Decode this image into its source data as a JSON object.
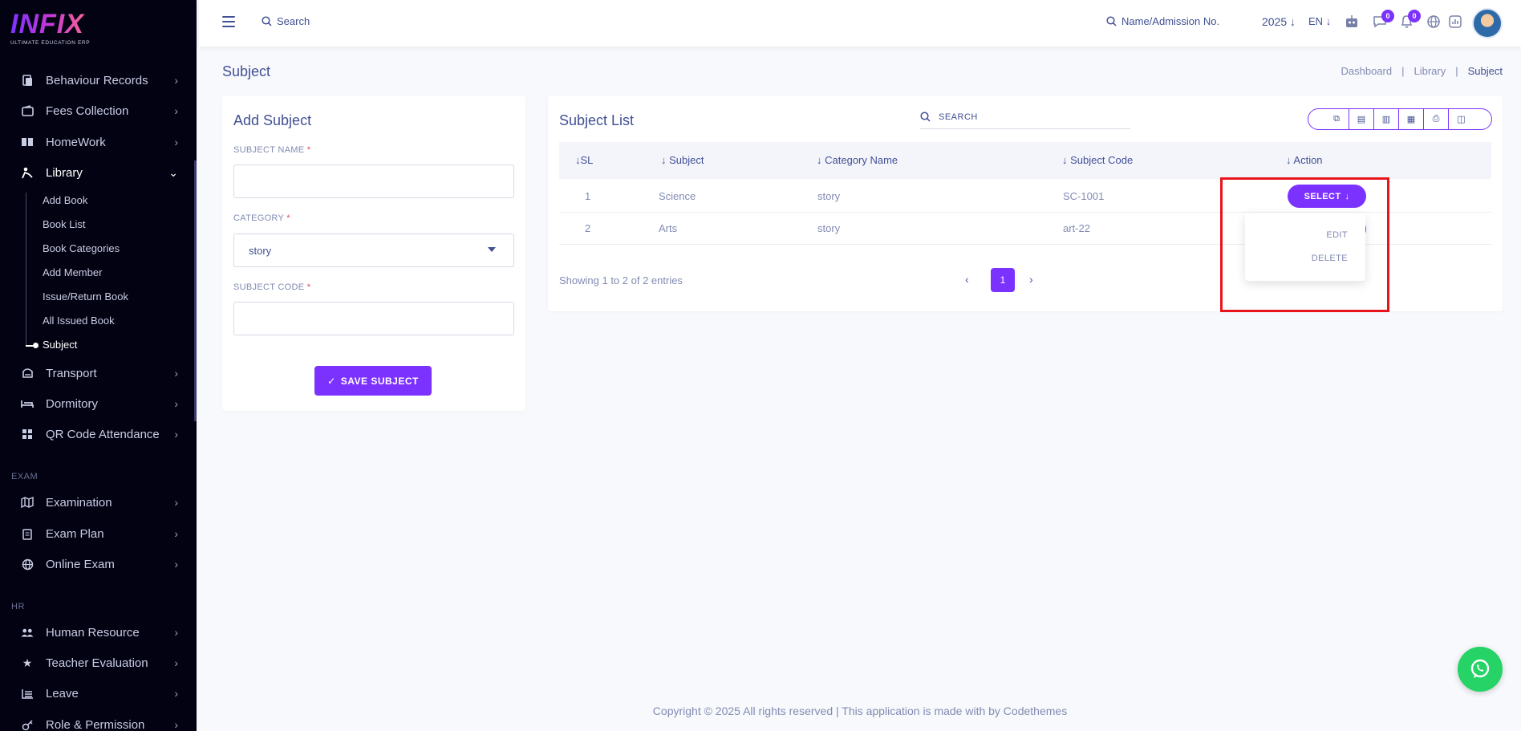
{
  "logo": {
    "text": "INFIX",
    "subtitle": "ULTIMATE EDUCATION ERP"
  },
  "sidebar": {
    "items": [
      {
        "label": "Behaviour Records",
        "icon": "document-icon"
      },
      {
        "label": "Fees Collection",
        "icon": "wallet-icon"
      },
      {
        "label": "HomeWork",
        "icon": "book-open-icon"
      },
      {
        "label": "Library",
        "icon": "reader-icon"
      },
      {
        "label": "Transport",
        "icon": "bus-icon"
      },
      {
        "label": "Dormitory",
        "icon": "bed-icon"
      },
      {
        "label": "QR Code Attendance",
        "icon": "qr-grid-icon"
      },
      {
        "label": "Examination",
        "icon": "map-icon"
      },
      {
        "label": "Exam Plan",
        "icon": "clipboard-icon"
      },
      {
        "label": "Online Exam",
        "icon": "globe-icon"
      },
      {
        "label": "Human Resource",
        "icon": "users-icon"
      },
      {
        "label": "Teacher Evaluation",
        "icon": "star-icon"
      },
      {
        "label": "Leave",
        "icon": "list-icon"
      },
      {
        "label": "Role & Permission",
        "icon": "key-icon"
      }
    ],
    "library_sub": [
      "Add Book",
      "Book List",
      "Book Categories",
      "Add Member",
      "Issue/Return Book",
      "All Issued Book",
      "Subject"
    ],
    "sections": {
      "exam": "EXAM",
      "hr": "HR"
    }
  },
  "header": {
    "search_placeholder": "Search",
    "admission_placeholder": "Name/Admission No.",
    "year": "2025",
    "lang": "EN",
    "chat_count": "0",
    "notif_count": "0"
  },
  "page": {
    "title": "Subject",
    "breadcrumb": [
      "Dashboard",
      "Library",
      "Subject"
    ]
  },
  "add_subject": {
    "title": "Add Subject",
    "subject_name_label": "SUBJECT NAME",
    "category_label": "CATEGORY",
    "category_value": "story",
    "subject_code_label": "SUBJECT CODE",
    "required_mark": "*",
    "save_label": "SAVE SUBJECT"
  },
  "subject_list": {
    "title": "Subject List",
    "search_placeholder": "SEARCH",
    "columns": [
      "SL",
      "Subject",
      "Category Name",
      "Subject Code",
      "Action"
    ],
    "rows": [
      {
        "sl": "1",
        "subject": "Science",
        "category": "story",
        "code": "SC-1001"
      },
      {
        "sl": "2",
        "subject": "Arts",
        "category": "story",
        "code": "art-22"
      }
    ],
    "select_label": "SELECT",
    "dropdown": [
      "EDIT",
      "DELETE"
    ],
    "showing": "Showing 1 to 2 of 2 entries",
    "current_page": "1"
  },
  "footer": {
    "text": "Copyright © 2025 All rights reserved | This application is made with by Codethemes"
  },
  "colors": {
    "primary": "#7c32ff",
    "text": "#415094",
    "muted": "#828bb2",
    "sidebar_bg": "#020212",
    "highlight": "#e8141b"
  }
}
